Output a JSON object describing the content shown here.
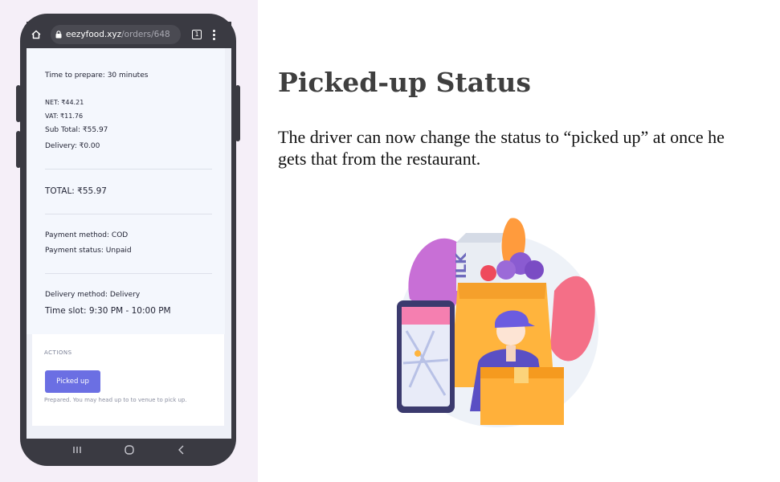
{
  "browser": {
    "url_host": "eezyfood.xyz",
    "url_path": "/orders/648",
    "tab_count": "1"
  },
  "order": {
    "prep_time": "Time to prepare: 30 minutes",
    "net": "NET: ₹44.21",
    "vat": "VAT: ₹11.76",
    "sub_total": "Sub Total: ₹55.97",
    "delivery_fee": "Delivery: ₹0.00",
    "total": "TOTAL: ₹55.97",
    "payment_method": "Payment method: COD",
    "payment_status": "Payment status: Unpaid",
    "delivery_method": "Delivery method: Delivery",
    "time_slot": "Time slot: 9:30 PM - 10:00 PM"
  },
  "actions": {
    "label": "ACTIONS",
    "button_label": "Picked up",
    "helper": "Prepared. You may head up to to venue to pick up."
  },
  "slide": {
    "title": "Picked-up Status",
    "description": "The driver can now change the status to “picked up” at once he gets that from the restaurant."
  },
  "colors": {
    "accent": "#6b6fe3",
    "phone_frame": "#3a3a42",
    "panel_bg": "#f5eff8"
  },
  "icons": [
    "home-icon",
    "lock-icon",
    "tab-switcher-icon",
    "more-menu-icon",
    "recent-apps-icon",
    "home-circle-icon",
    "back-icon"
  ]
}
